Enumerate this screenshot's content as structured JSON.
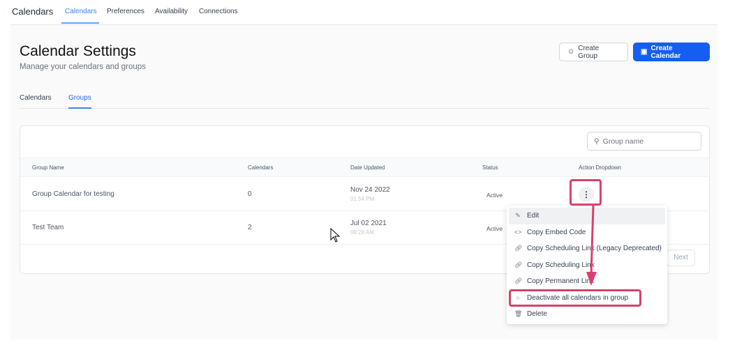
{
  "topnav": {
    "brand": "Calendars",
    "tabs": [
      {
        "label": "Calendars",
        "active": true
      },
      {
        "label": "Preferences"
      },
      {
        "label": "Availability"
      },
      {
        "label": "Connections"
      }
    ]
  },
  "page": {
    "title": "Calendar Settings",
    "subtitle": "Manage your calendars and groups",
    "create_group": "Create Group",
    "create_calendar": "Create Calendar"
  },
  "subtabs": [
    {
      "label": "Calendars"
    },
    {
      "label": "Groups",
      "active": true
    }
  ],
  "search": {
    "placeholder": "Group name"
  },
  "table": {
    "headers": [
      "Group Name",
      "Calendars",
      "Date Updated",
      "Status",
      "Action Dropdown"
    ],
    "rows": [
      {
        "name": "Group Calendar for testing",
        "calendars": "0",
        "date": "Nov 24 2022",
        "time": "01:54 PM",
        "status": "Active"
      },
      {
        "name": "Test Team",
        "calendars": "2",
        "date": "Jul 02 2021",
        "time": "08:28 AM",
        "status": "Active"
      }
    ]
  },
  "pagination": {
    "next": "Next"
  },
  "menu": {
    "items": [
      {
        "label": "Edit",
        "icon": "pencil-icon"
      },
      {
        "label": "Copy Embed Code",
        "icon": "code-icon"
      },
      {
        "label": "Copy Scheduling Link (Legacy Deprecated)",
        "icon": "link-icon"
      },
      {
        "label": "Copy Scheduling Link",
        "icon": "link-icon"
      },
      {
        "label": "Copy Permanent Link",
        "icon": "link-icon"
      },
      {
        "label": "Deactivate all calendars in group",
        "icon": "power-icon"
      },
      {
        "label": "Delete",
        "icon": "trash-icon"
      }
    ]
  },
  "colors": {
    "primary": "#155eef",
    "annotation": "#d9406b"
  }
}
